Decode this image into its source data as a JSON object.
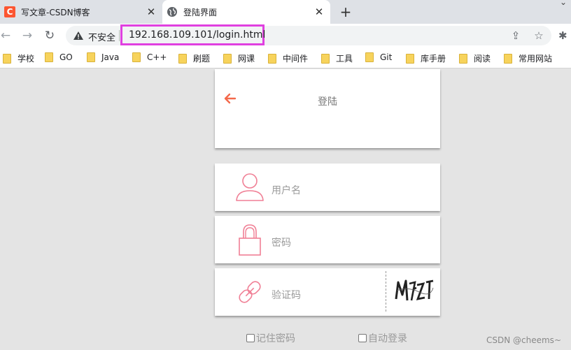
{
  "browser": {
    "tabs": [
      {
        "title": "写文章-CSDN博客",
        "favicon": "C",
        "close": "✕"
      },
      {
        "title": "登陆界面",
        "close": "✕"
      }
    ],
    "new_tab": "+",
    "tab_menu": "⌄",
    "nav": {
      "back": "←",
      "forward": "→",
      "reload": "↻"
    },
    "address": {
      "security_text": "不安全",
      "url": "192.168.109.101/login.html"
    },
    "omnibox_icons": {
      "share": "⇪",
      "star": "☆"
    },
    "extensions": "✱",
    "bookmarks": [
      "学校",
      "GO",
      "Java",
      "C++",
      "刷题",
      "网课",
      "中间件",
      "工具",
      "Git",
      "库手册",
      "阅读",
      "常用网站"
    ]
  },
  "login": {
    "title": "登陆",
    "username_placeholder": "用户名",
    "password_placeholder": "密码",
    "captcha_placeholder": "验证码",
    "remember_password": "记住密码",
    "auto_login": "自动登录"
  },
  "watermark": "CSDN @cheems~",
  "colors": {
    "accent": "#f4694b",
    "icon_pink": "#f07f95",
    "url_highlight": "#e040e0"
  }
}
